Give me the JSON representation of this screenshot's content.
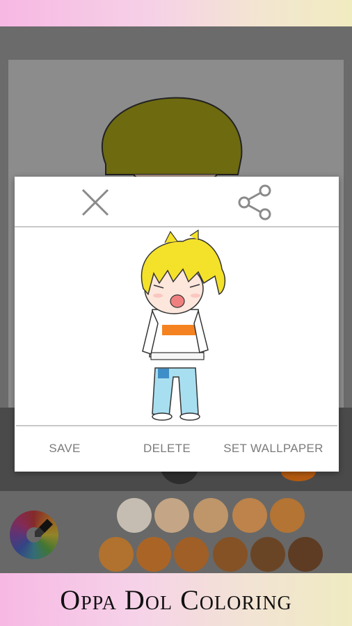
{
  "app": {
    "title": "Oppa Dol Coloring"
  },
  "dialog": {
    "close_icon": "close-icon",
    "share_icon": "share-icon",
    "actions": {
      "save": "SAVE",
      "delete": "DELETE",
      "set_wallpaper": "SET WALLPAPER"
    }
  },
  "palette": {
    "colors": [
      "#e4d9c9",
      "#e3b98f",
      "#dba56b",
      "#d98c40",
      "#cc7823",
      "#c8761b",
      "#c06410",
      "#b35c10",
      "#8f4b10",
      "#6b3a0f",
      "#5a2e0c"
    ]
  }
}
